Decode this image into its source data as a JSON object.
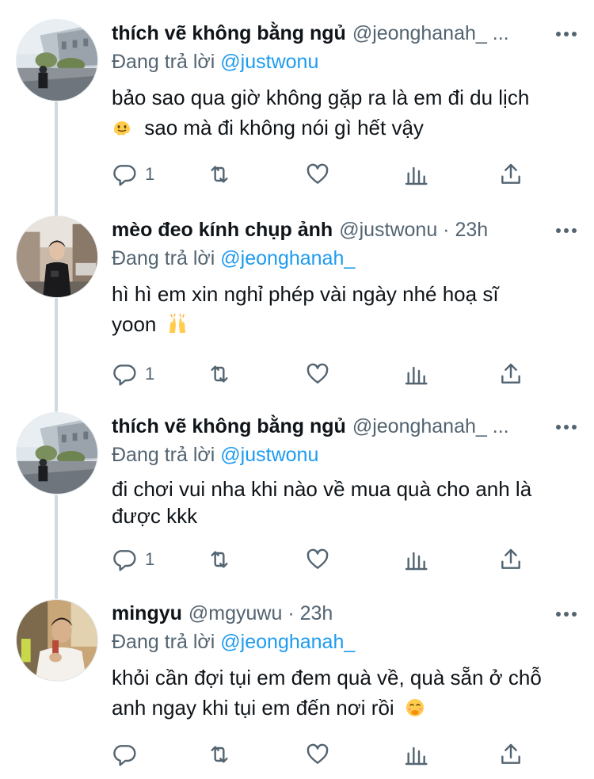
{
  "tweets": [
    {
      "display_name": "thích vẽ không bằng ngủ",
      "handle": "@jeonghanah_ ...",
      "reply_label": "Đang trả lời",
      "reply_to": "@justwonu",
      "text_1": "bảo sao qua giờ không gặp ra là em đi du lịch",
      "text_2": "sao mà đi không nói gì hết vậy",
      "emoji": "melting-face",
      "reply_count": "1",
      "avatar": "street-photo-avatar"
    },
    {
      "display_name": "mèo đeo kính chụp ảnh",
      "handle": "@justwonu · 23h",
      "reply_label": "Đang trả lời",
      "reply_to": "@jeonghanah_",
      "text_1": "hì hì em xin nghỉ phép vài ngày nhé hoạ sĩ",
      "text_2": "yoon",
      "emoji": "raising-hands",
      "reply_count": "1",
      "avatar": "man-street-photo-avatar"
    },
    {
      "display_name": "thích vẽ không bằng ngủ",
      "handle": "@jeonghanah_ ...",
      "reply_label": "Đang trả lời",
      "reply_to": "@justwonu",
      "text_1": "đi chơi vui nha khi nào về mua quà cho anh là",
      "text_2": "được kkk",
      "emoji": "",
      "reply_count": "1",
      "avatar": "street-photo-avatar"
    },
    {
      "display_name": "mingyu",
      "handle": "@mgyuwu · 23h",
      "reply_label": "Đang trả lời",
      "reply_to": "@jeonghanah_",
      "text_1": "khỏi cần đợi tụi em đem quà về, quà sẵn ở chỗ",
      "text_2": "anh ngay khi tụi em đến nơi rồi",
      "emoji": "face-with-hand-over-mouth",
      "reply_count": "",
      "avatar": "man-indoor-photo-avatar"
    }
  ],
  "colors": {
    "text": "#0f1419",
    "secondary": "#536471",
    "link": "#1d9bf0",
    "thread_line": "#cfd9de"
  }
}
